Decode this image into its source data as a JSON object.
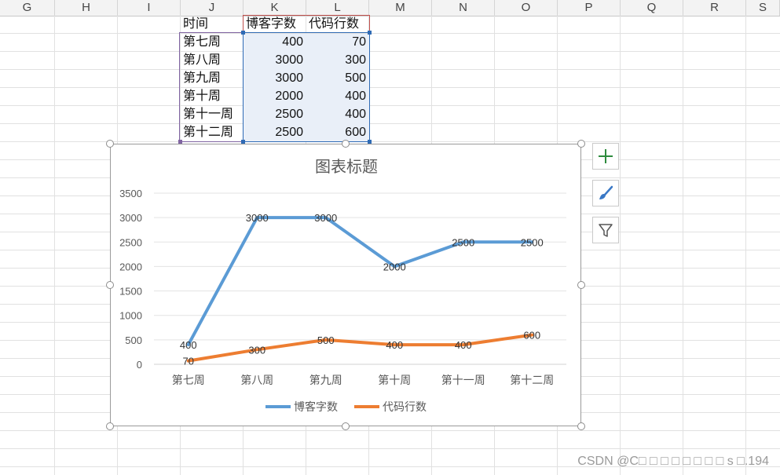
{
  "columns": [
    "G",
    "H",
    "I",
    "J",
    "K",
    "L",
    "M",
    "N",
    "O",
    "P",
    "Q",
    "R",
    "S"
  ],
  "table": {
    "headers": [
      "时间",
      "博客字数",
      "代码行数"
    ],
    "rows": [
      [
        "第七周",
        "400",
        "70"
      ],
      [
        "第八周",
        "3000",
        "300"
      ],
      [
        "第九周",
        "3000",
        "500"
      ],
      [
        "第十周",
        "2000",
        "400"
      ],
      [
        "第十一周",
        "2500",
        "400"
      ],
      [
        "第十二周",
        "2500",
        "600"
      ]
    ]
  },
  "colors": {
    "series1": "#5b9bd5",
    "series2": "#ed7d31",
    "plus": "#2e8b3e",
    "brush": "#3a78c6"
  },
  "chart_data": {
    "type": "line",
    "title": "图表标题",
    "categories": [
      "第七周",
      "第八周",
      "第九周",
      "第十周",
      "第十一周",
      "第十二周"
    ],
    "series": [
      {
        "name": "博客字数",
        "values": [
          400,
          3000,
          3000,
          2000,
          2500,
          2500
        ]
      },
      {
        "name": "代码行数",
        "values": [
          70,
          300,
          500,
          400,
          400,
          600
        ]
      }
    ],
    "ylim": [
      0,
      3500
    ],
    "yticks": [
      0,
      500,
      1000,
      1500,
      2000,
      2500,
      3000,
      3500
    ],
    "grid": true,
    "legend": "bottom",
    "data_labels": true
  },
  "side_buttons": [
    "plus-icon",
    "brush-icon",
    "filter-icon"
  ],
  "watermark": "CSDN @C□ □ □ □ □ □ □ □ s □.194"
}
